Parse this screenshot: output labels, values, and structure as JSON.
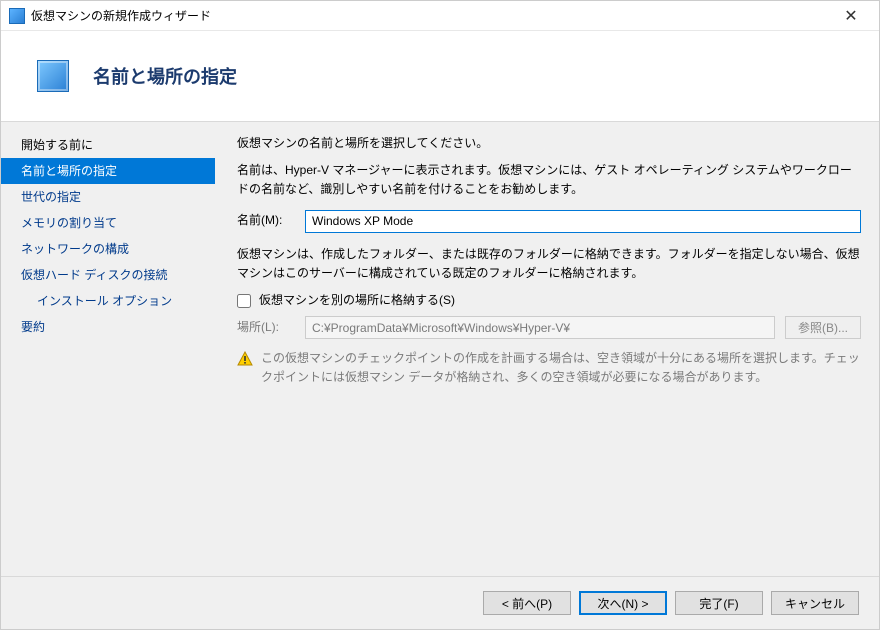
{
  "window": {
    "title": "仮想マシンの新規作成ウィザード"
  },
  "header": {
    "heading": "名前と場所の指定"
  },
  "sidebar": {
    "items": [
      {
        "label": "開始する前に",
        "active": false,
        "indent": false,
        "plain": true
      },
      {
        "label": "名前と場所の指定",
        "active": true,
        "indent": false,
        "plain": false
      },
      {
        "label": "世代の指定",
        "active": false,
        "indent": false,
        "plain": false
      },
      {
        "label": "メモリの割り当て",
        "active": false,
        "indent": false,
        "plain": false
      },
      {
        "label": "ネットワークの構成",
        "active": false,
        "indent": false,
        "plain": false
      },
      {
        "label": "仮想ハード ディスクの接続",
        "active": false,
        "indent": false,
        "plain": false
      },
      {
        "label": "インストール オプション",
        "active": false,
        "indent": true,
        "plain": false
      },
      {
        "label": "要約",
        "active": false,
        "indent": false,
        "plain": false
      }
    ]
  },
  "content": {
    "intro": "仮想マシンの名前と場所を選択してください。",
    "name_desc": "名前は、Hyper-V マネージャーに表示されます。仮想マシンには、ゲスト オペレーティング システムやワークロードの名前など、識別しやすい名前を付けることをお勧めします。",
    "name_label": "名前(M):",
    "name_value": "Windows XP Mode",
    "location_desc": "仮想マシンは、作成したフォルダー、または既存のフォルダーに格納できます。フォルダーを指定しない場合、仮想マシンはこのサーバーに構成されている既定のフォルダーに格納されます。",
    "checkbox_label": "仮想マシンを別の場所に格納する(S)",
    "location_label": "場所(L):",
    "location_value": "C:¥ProgramData¥Microsoft¥Windows¥Hyper-V¥",
    "browse_label": "参照(B)...",
    "warning_text": "この仮想マシンのチェックポイントの作成を計画する場合は、空き領域が十分にある場所を選択します。チェックポイントには仮想マシン データが格納され、多くの空き領域が必要になる場合があります。"
  },
  "footer": {
    "back": "< 前へ(P)",
    "next": "次へ(N) >",
    "finish": "完了(F)",
    "cancel": "キャンセル"
  }
}
